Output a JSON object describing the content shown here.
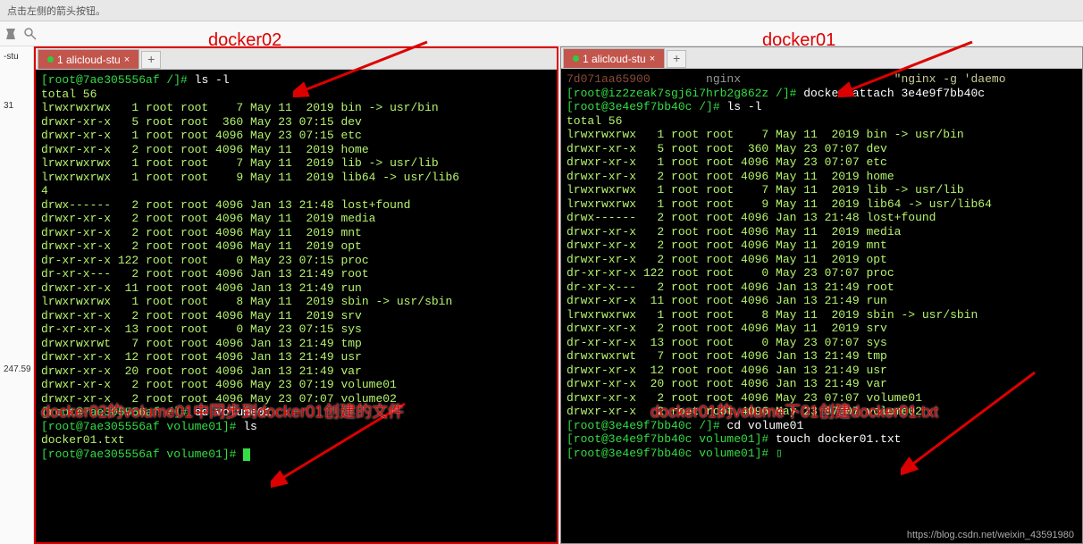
{
  "topbar": {
    "hint": "点击左侧的箭头按钮。"
  },
  "sidebar": {
    "items": [
      {
        "label": "-stu"
      },
      {
        "label": "31"
      },
      {
        "label": "247.59"
      }
    ]
  },
  "labels": {
    "left": "docker02",
    "right": "docker01"
  },
  "annotations": {
    "left": "docker02的volume01中同步到docker01创建的文件",
    "right": "docker01的volume下01创建docker01.txt"
  },
  "tabs": {
    "left": {
      "title": "1 alicloud-stu",
      "active": true
    },
    "right": {
      "title": "1 alicloud-stu",
      "active": true
    }
  },
  "terminal_left": {
    "lines": [
      {
        "t": "prompt",
        "br": "[root@7ae305556af /]# ",
        "cmd": "ls -l"
      },
      {
        "t": "out",
        "v": "total 56"
      },
      {
        "t": "out",
        "v": "lrwxrwxrwx   1 root root    7 May 11  2019 bin -> usr/bin"
      },
      {
        "t": "out",
        "v": "drwxr-xr-x   5 root root  360 May 23 07:15 dev"
      },
      {
        "t": "out",
        "v": "drwxr-xr-x   1 root root 4096 May 23 07:15 etc"
      },
      {
        "t": "out",
        "v": "drwxr-xr-x   2 root root 4096 May 11  2019 home"
      },
      {
        "t": "out",
        "v": "lrwxrwxrwx   1 root root    7 May 11  2019 lib -> usr/lib"
      },
      {
        "t": "out",
        "v": "lrwxrwxrwx   1 root root    9 May 11  2019 lib64 -> usr/lib6"
      },
      {
        "t": "out",
        "v": "4"
      },
      {
        "t": "out",
        "v": "drwx------   2 root root 4096 Jan 13 21:48 lost+found"
      },
      {
        "t": "out",
        "v": "drwxr-xr-x   2 root root 4096 May 11  2019 media"
      },
      {
        "t": "out",
        "v": "drwxr-xr-x   2 root root 4096 May 11  2019 mnt"
      },
      {
        "t": "out",
        "v": "drwxr-xr-x   2 root root 4096 May 11  2019 opt"
      },
      {
        "t": "out",
        "v": "dr-xr-xr-x 122 root root    0 May 23 07:15 proc"
      },
      {
        "t": "out",
        "v": "dr-xr-x---   2 root root 4096 Jan 13 21:49 root"
      },
      {
        "t": "out",
        "v": "drwxr-xr-x  11 root root 4096 Jan 13 21:49 run"
      },
      {
        "t": "out",
        "v": "lrwxrwxrwx   1 root root    8 May 11  2019 sbin -> usr/sbin"
      },
      {
        "t": "out",
        "v": "drwxr-xr-x   2 root root 4096 May 11  2019 srv"
      },
      {
        "t": "out",
        "v": "dr-xr-xr-x  13 root root    0 May 23 07:15 sys"
      },
      {
        "t": "out",
        "v": "drwxrwxrwt   7 root root 4096 Jan 13 21:49 tmp"
      },
      {
        "t": "out",
        "v": "drwxr-xr-x  12 root root 4096 Jan 13 21:49 usr"
      },
      {
        "t": "out",
        "v": "drwxr-xr-x  20 root root 4096 Jan 13 21:49 var"
      },
      {
        "t": "out",
        "v": "drwxr-xr-x   2 root root 4096 May 23 07:19 volume01"
      },
      {
        "t": "out",
        "v": "drwxr-xr-x   2 root root 4096 May 23 07:07 volume02"
      },
      {
        "t": "prompt",
        "br": "[root@7ae305556af /]# ",
        "cmd": "cd volume01"
      },
      {
        "t": "prompt",
        "br": "[root@7ae305556af volume01]# ",
        "cmd": "ls"
      },
      {
        "t": "out",
        "v": "docker01.txt"
      },
      {
        "t": "prompt",
        "br": "[root@7ae305556af volume01]# ",
        "cmd": "",
        "cursor": true
      }
    ]
  },
  "terminal_right": {
    "lines": [
      {
        "t": "raw",
        "parts": [
          {
            "c": "cont-id",
            "v": "7d071aa65900        "
          },
          {
            "c": "nginx",
            "v": "nginx                      "
          },
          {
            "c": "quote",
            "v": "\"nginx -g 'daemo"
          }
        ]
      },
      {
        "t": "prompt",
        "br": "[root@iz2zeak7sgj6i7hrb2g862z /]# ",
        "cmd": "docker attach 3e4e9f7bb40c"
      },
      {
        "t": "prompt",
        "br": "[root@3e4e9f7bb40c /]# ",
        "cmd": "ls -l"
      },
      {
        "t": "out",
        "v": "total 56"
      },
      {
        "t": "out",
        "v": "lrwxrwxrwx   1 root root    7 May 11  2019 bin -> usr/bin"
      },
      {
        "t": "out",
        "v": "drwxr-xr-x   5 root root  360 May 23 07:07 dev"
      },
      {
        "t": "out",
        "v": "drwxr-xr-x   1 root root 4096 May 23 07:07 etc"
      },
      {
        "t": "out",
        "v": "drwxr-xr-x   2 root root 4096 May 11  2019 home"
      },
      {
        "t": "out",
        "v": "lrwxrwxrwx   1 root root    7 May 11  2019 lib -> usr/lib"
      },
      {
        "t": "out",
        "v": "lrwxrwxrwx   1 root root    9 May 11  2019 lib64 -> usr/lib64"
      },
      {
        "t": "out",
        "v": "drwx------   2 root root 4096 Jan 13 21:48 lost+found"
      },
      {
        "t": "out",
        "v": "drwxr-xr-x   2 root root 4096 May 11  2019 media"
      },
      {
        "t": "out",
        "v": "drwxr-xr-x   2 root root 4096 May 11  2019 mnt"
      },
      {
        "t": "out",
        "v": "drwxr-xr-x   2 root root 4096 May 11  2019 opt"
      },
      {
        "t": "out",
        "v": "dr-xr-xr-x 122 root root    0 May 23 07:07 proc"
      },
      {
        "t": "out",
        "v": "dr-xr-x---   2 root root 4096 Jan 13 21:49 root"
      },
      {
        "t": "out",
        "v": "drwxr-xr-x  11 root root 4096 Jan 13 21:49 run"
      },
      {
        "t": "out",
        "v": "lrwxrwxrwx   1 root root    8 May 11  2019 sbin -> usr/sbin"
      },
      {
        "t": "out",
        "v": "drwxr-xr-x   2 root root 4096 May 11  2019 srv"
      },
      {
        "t": "out",
        "v": "dr-xr-xr-x  13 root root    0 May 23 07:07 sys"
      },
      {
        "t": "out",
        "v": "drwxrwxrwt   7 root root 4096 Jan 13 21:49 tmp"
      },
      {
        "t": "out",
        "v": "drwxr-xr-x  12 root root 4096 Jan 13 21:49 usr"
      },
      {
        "t": "out",
        "v": "drwxr-xr-x  20 root root 4096 Jan 13 21:49 var"
      },
      {
        "t": "out",
        "v": "drwxr-xr-x   2 root root 4096 May 23 07:07 volume01"
      },
      {
        "t": "out",
        "v": "drwxr-xr-x   2 root root 4096 May 23 07:07 volume02"
      },
      {
        "t": "prompt",
        "br": "[root@3e4e9f7bb40c /]# ",
        "cmd": "cd volume01"
      },
      {
        "t": "prompt",
        "br": "[root@3e4e9f7bb40c volume01]# ",
        "cmd": "touch docker01.txt"
      },
      {
        "t": "prompt",
        "br": "[root@3e4e9f7bb40c volume01]# ",
        "cmd": "",
        "cursor_outline": true
      }
    ]
  },
  "watermark": "https://blog.csdn.net/weixin_43591980"
}
